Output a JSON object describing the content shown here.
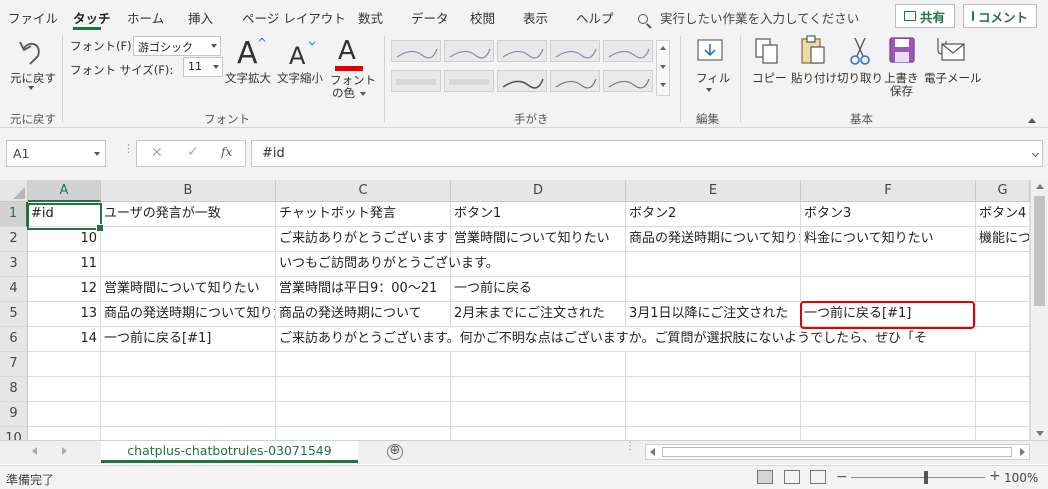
{
  "menu": {
    "tabs": [
      "ファイル",
      "タッチ",
      "ホーム",
      "挿入",
      "ページ レイアウト",
      "数式",
      "データ",
      "校閲",
      "表示",
      "ヘルプ"
    ],
    "active_tab": "タッチ",
    "tell_me": "実行したい作業を入力してください",
    "share": "共有",
    "comment": "コメント"
  },
  "ribbon": {
    "undo": {
      "line1": "元に戻す",
      "group": "元に戻す"
    },
    "font": {
      "font_label": "フォント(F):",
      "font_value": "游ゴシック",
      "size_label": "フォント サイズ(F):",
      "size_value": "11",
      "grow": "文字拡大",
      "shrink": "文字縮小",
      "color_line1": "フォント",
      "color_line2": "の色",
      "group": "フォント"
    },
    "handwriting": {
      "group": "手がき"
    },
    "edit": {
      "fill": "フィル",
      "group": "編集"
    },
    "basic": {
      "copy": "コピー",
      "paste": "貼り付け",
      "cut": "切り取り",
      "save_line1": "上書き",
      "save_line2": "保存",
      "email": "電子メール",
      "group": "基本"
    },
    "colors": {
      "accent": "#217346",
      "font_color_bar": "#e00000"
    }
  },
  "formula_bar": {
    "name_box": "A1",
    "fx": "fx",
    "formula": "#id"
  },
  "grid": {
    "columns": [
      "A",
      "B",
      "C",
      "D",
      "E",
      "F",
      "G"
    ],
    "rows": [
      "1",
      "2",
      "3",
      "4",
      "5",
      "6",
      "7",
      "8",
      "9",
      "10"
    ],
    "cells": {
      "r1": [
        "#id",
        "ユーザの発言が一致",
        "チャットボット発言",
        "ボタン1",
        "ボタン2",
        "ボタン3",
        "ボタン4"
      ],
      "r2": [
        "10",
        "",
        "ご来訪ありがとうございます",
        "営業時間について知りたい",
        "商品の発送時期について知りたい",
        "料金について知りたい",
        "機能について"
      ],
      "r3": [
        "11",
        "",
        "いつもご訪問ありがとうございます。",
        "",
        "",
        "",
        ""
      ],
      "r4": [
        "12",
        "営業時間について知りたい",
        "営業時間は平日9：00～21",
        "一つ前に戻る",
        "",
        "",
        ""
      ],
      "r5": [
        "13",
        "商品の発送時期について知りたい",
        "商品の発送時期について",
        "2月末までにご注文された",
        "3月1日以降にご注文された",
        "一つ前に戻る[#1]",
        ""
      ],
      "r6": [
        "14",
        "一つ前に戻る[#1]",
        "ご来訪ありがとうございます。何かご不明な点はございますか。ご質問が選択肢にないようでしたら、ぜひ「そ",
        "",
        "",
        "",
        ""
      ]
    }
  },
  "sheets": {
    "active": "chatplus-chatbotrules-03071549",
    "add": "⊕"
  },
  "status": {
    "text": "準備完了",
    "zoom": "100%",
    "zoom_minus": "−",
    "zoom_plus": "+"
  }
}
